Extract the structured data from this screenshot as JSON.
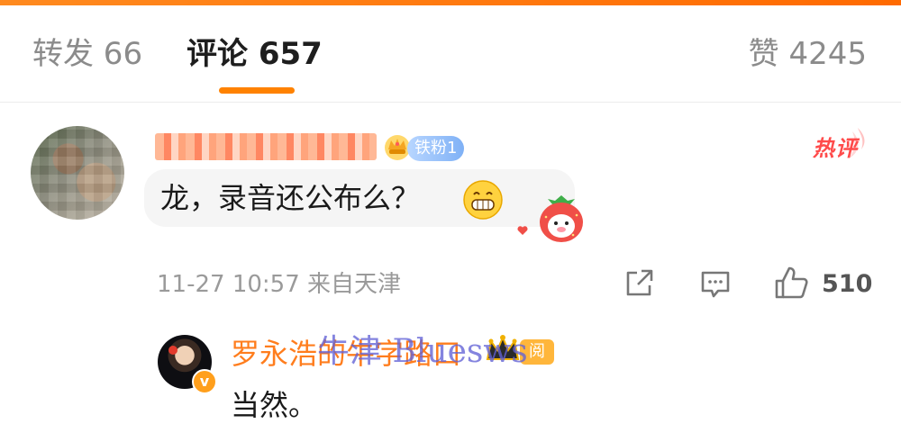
{
  "tabs": {
    "forward": "转发 66",
    "comments": "评论 657",
    "likes": "赞 4245"
  },
  "comment": {
    "fan_badge": "铁粉1",
    "hot_label": "热评",
    "text": "龙，录音还公布么？",
    "timestamp": "11-27 10:57",
    "location": "来自天津",
    "like_count": "510",
    "icons": {
      "avatar": "blurred-avatar",
      "username": "blurred-username",
      "crown": "crown-badge-icon",
      "emoji": "grinning-face-icon",
      "sticker": "strawberry-sticker-icon",
      "share": "share-icon",
      "reply": "comment-icon",
      "like": "thumbs-up-icon"
    }
  },
  "reply": {
    "name": "罗永浩的牛字路口",
    "tag": "阅",
    "text": "当然。",
    "watermark": "牛津 Bluesws"
  },
  "colors": {
    "accent": "#ff8200",
    "name_orange": "#ff7d1d",
    "hot_red": "#ff4b4b",
    "fan_badge_blue": "#7fb1f6",
    "watermark_purple": "#6262d6"
  }
}
